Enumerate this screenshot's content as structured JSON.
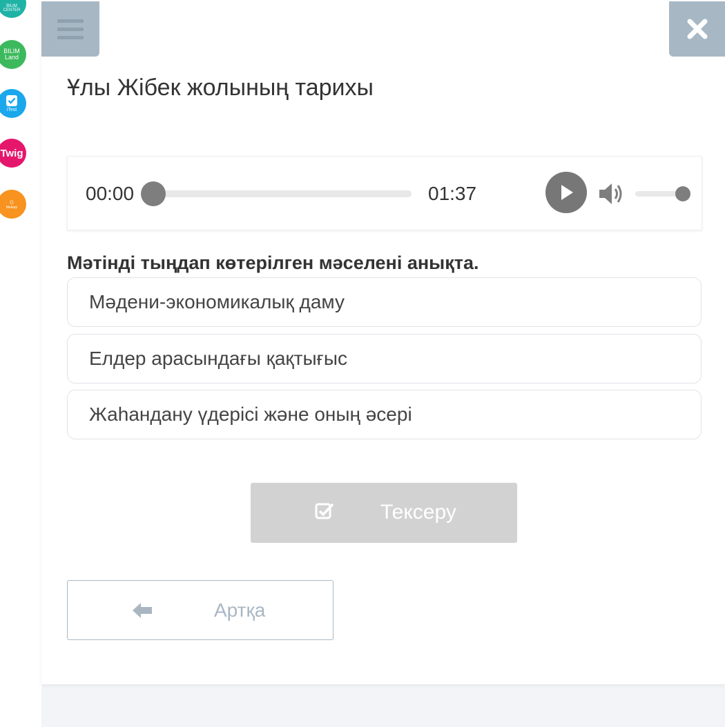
{
  "sidebar": {
    "apps": [
      {
        "icon": "bilim-center-icon",
        "label": "BILIM CENTER",
        "color": "#1fb3a6"
      },
      {
        "icon": "bilim-land-icon",
        "label": "BILIM Land",
        "color": "#3cb95d"
      },
      {
        "icon": "itest-icon",
        "label": "iTest",
        "color": "#1aa7ec"
      },
      {
        "icon": "twig-icon",
        "label": "Twig",
        "color": "#e5176c"
      },
      {
        "icon": "mektep-icon",
        "label": "Mektep",
        "color": "#f7931e"
      }
    ]
  },
  "header": {
    "menu_icon": "hamburger-icon",
    "close_icon": "close-icon",
    "bar_color": "#a7b8c4"
  },
  "lesson": {
    "title": "Ұлы Жібек жолының тарихы"
  },
  "audio_player": {
    "current_time": "00:00",
    "duration": "01:37",
    "progress": 0,
    "volume": 1.0,
    "play_icon": "play-icon",
    "volume_icon": "volume-icon"
  },
  "question": {
    "text": "Мәтінді тыңдап көтерілген мәселені анықта.",
    "options": [
      "Мәдени-экономикалық даму",
      "Елдер арасындағы қақтығыс",
      "Жаһандану үдерісі және оның әсері"
    ]
  },
  "actions": {
    "check_label": "Тексеру",
    "check_icon": "checkbox-check-icon",
    "back_label": "Артқа",
    "back_icon": "arrow-left-icon"
  }
}
